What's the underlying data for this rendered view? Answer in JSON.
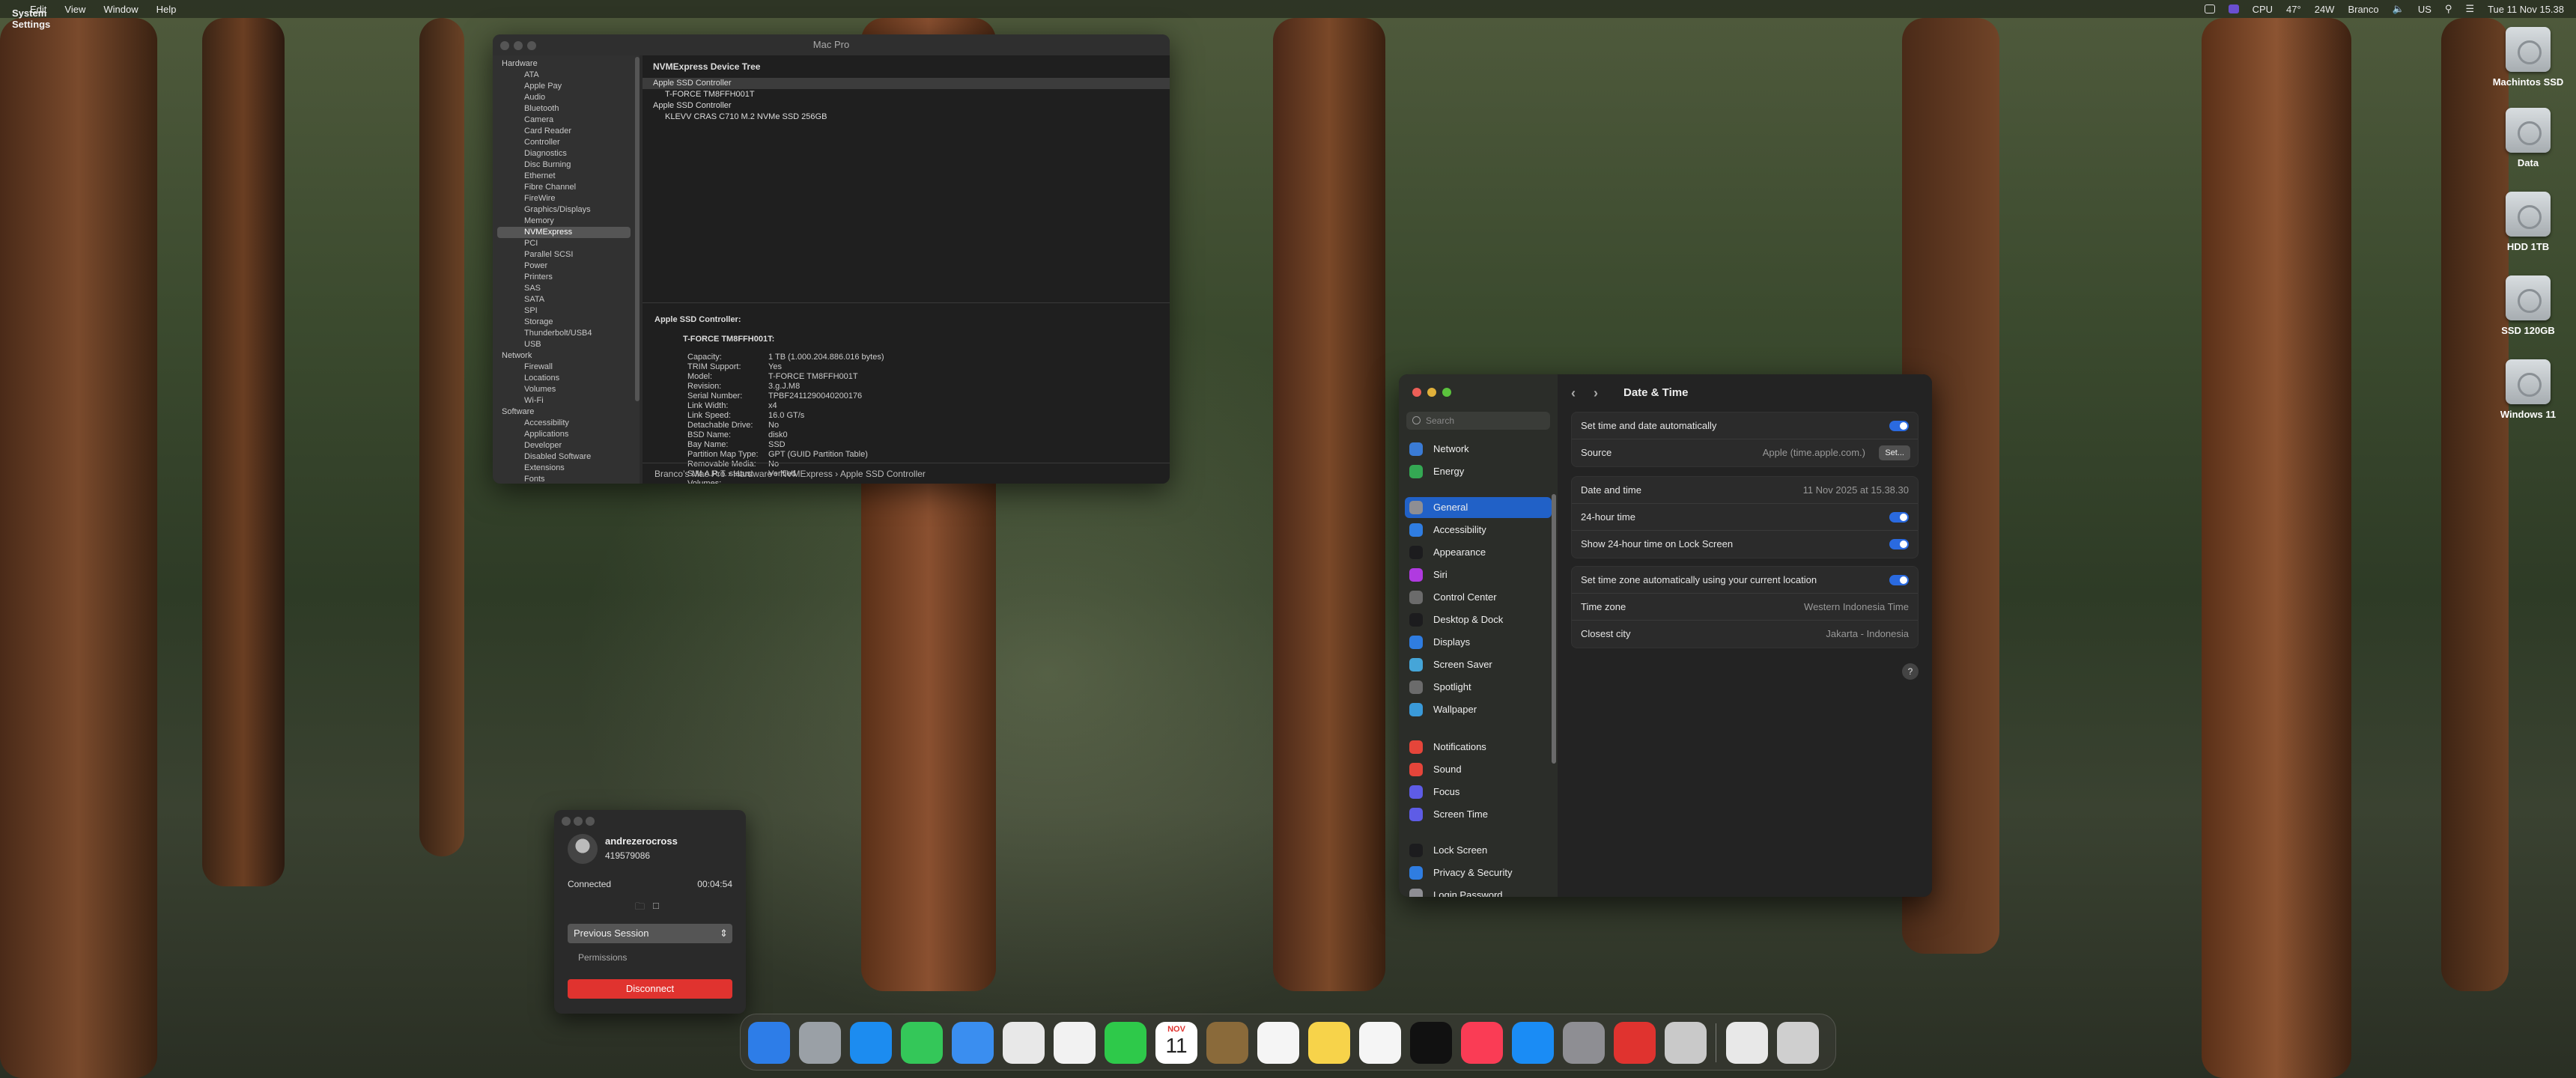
{
  "menubar": {
    "apple": "",
    "app": "System Settings",
    "items": [
      "Edit",
      "View",
      "Window",
      "Help"
    ],
    "cpu": "CPU",
    "temp": "47°",
    "power": "24W",
    "user": "Branco",
    "input": "US",
    "clock": "Tue 11 Nov 15.38"
  },
  "desktop": {
    "icons": [
      "Machintos SSD",
      "Data",
      "HDD 1TB",
      "SSD 120GB",
      "Windows 11"
    ]
  },
  "sysinfo": {
    "title": "Mac Pro",
    "sidebar": [
      {
        "t": "g",
        "label": "Hardware"
      },
      {
        "t": "i",
        "label": "ATA"
      },
      {
        "t": "i",
        "label": "Apple Pay"
      },
      {
        "t": "i",
        "label": "Audio"
      },
      {
        "t": "i",
        "label": "Bluetooth"
      },
      {
        "t": "i",
        "label": "Camera"
      },
      {
        "t": "i",
        "label": "Card Reader"
      },
      {
        "t": "i",
        "label": "Controller"
      },
      {
        "t": "i",
        "label": "Diagnostics"
      },
      {
        "t": "i",
        "label": "Disc Burning"
      },
      {
        "t": "i",
        "label": "Ethernet"
      },
      {
        "t": "i",
        "label": "Fibre Channel"
      },
      {
        "t": "i",
        "label": "FireWire"
      },
      {
        "t": "i",
        "label": "Graphics/Displays"
      },
      {
        "t": "i",
        "label": "Memory"
      },
      {
        "t": "s",
        "label": "NVMExpress"
      },
      {
        "t": "i",
        "label": "PCI"
      },
      {
        "t": "i",
        "label": "Parallel SCSI"
      },
      {
        "t": "i",
        "label": "Power"
      },
      {
        "t": "i",
        "label": "Printers"
      },
      {
        "t": "i",
        "label": "SAS"
      },
      {
        "t": "i",
        "label": "SATA"
      },
      {
        "t": "i",
        "label": "SPI"
      },
      {
        "t": "i",
        "label": "Storage"
      },
      {
        "t": "i",
        "label": "Thunderbolt/USB4"
      },
      {
        "t": "i",
        "label": "USB"
      },
      {
        "t": "g",
        "label": "Network"
      },
      {
        "t": "i",
        "label": "Firewall"
      },
      {
        "t": "i",
        "label": "Locations"
      },
      {
        "t": "i",
        "label": "Volumes"
      },
      {
        "t": "i",
        "label": "Wi-Fi"
      },
      {
        "t": "g",
        "label": "Software"
      },
      {
        "t": "i",
        "label": "Accessibility"
      },
      {
        "t": "i",
        "label": "Applications"
      },
      {
        "t": "i",
        "label": "Developer"
      },
      {
        "t": "i",
        "label": "Disabled Software"
      },
      {
        "t": "i",
        "label": "Extensions"
      },
      {
        "t": "i",
        "label": "Fonts"
      }
    ],
    "tree_header": "NVMExpress Device Tree",
    "tree": [
      {
        "t": "r",
        "label": "Apple SSD Controller"
      },
      {
        "t": "c",
        "label": "T-FORCE TM8FFH001T"
      },
      {
        "t": "r",
        "label": "Apple SSD Controller"
      },
      {
        "t": "c",
        "label": "KLEVV CRAS C710 M.2 NVMe SSD 256GB"
      }
    ],
    "detail_title": "Apple SSD Controller:",
    "detail_sub": "T-FORCE TM8FFH001T:",
    "details": [
      {
        "k": "Capacity:",
        "v": "1 TB (1.000.204.886.016 bytes)"
      },
      {
        "k": "TRIM Support:",
        "v": "Yes"
      },
      {
        "k": "Model:",
        "v": "T-FORCE TM8FFH001T"
      },
      {
        "k": "Revision:",
        "v": "3.g.J.M8"
      },
      {
        "k": "Serial Number:",
        "v": "TPBF2411290040200176"
      },
      {
        "k": "Link Width:",
        "v": "x4"
      },
      {
        "k": "Link Speed:",
        "v": "16.0 GT/s"
      },
      {
        "k": "Detachable Drive:",
        "v": "No"
      },
      {
        "k": "BSD Name:",
        "v": "disk0"
      },
      {
        "k": "Bay Name:",
        "v": "SSD"
      },
      {
        "k": "Partition Map Type:",
        "v": "GPT (GUID Partition Table)"
      },
      {
        "k": "Removable Media:",
        "v": "No"
      },
      {
        "k": "S.M.A.R.T. status:",
        "v": "Verified"
      },
      {
        "k": "Volumes:",
        "v": ""
      }
    ],
    "breadcrumb": "Branco’s Mac Pro › Hardware › NVMExpress › Apple SSD Controller"
  },
  "settings": {
    "search_placeholder": "Search",
    "nav": [
      {
        "label": "Network",
        "color": "#3a7bd5"
      },
      {
        "label": "Energy",
        "color": "#34a853"
      },
      {
        "label": "General",
        "color": "#8e8e93",
        "active": true
      },
      {
        "label": "Accessibility",
        "color": "#2f7de1"
      },
      {
        "label": "Appearance",
        "color": "#1c1c1e"
      },
      {
        "label": "Siri",
        "color": "#b03ae0"
      },
      {
        "label": "Control Center",
        "color": "#6b6b6b"
      },
      {
        "label": "Desktop & Dock",
        "color": "#1c1c1e"
      },
      {
        "label": "Displays",
        "color": "#2f7de1"
      },
      {
        "label": "Screen Saver",
        "color": "#45a5d8"
      },
      {
        "label": "Spotlight",
        "color": "#6b6b6b"
      },
      {
        "label": "Wallpaper",
        "color": "#3a9ad9"
      },
      {
        "label": "Notifications",
        "color": "#e5453a"
      },
      {
        "label": "Sound",
        "color": "#e5453a"
      },
      {
        "label": "Focus",
        "color": "#5e5ce6"
      },
      {
        "label": "Screen Time",
        "color": "#5e5ce6"
      },
      {
        "label": "Lock Screen",
        "color": "#1c1c1e"
      },
      {
        "label": "Privacy & Security",
        "color": "#2f7de1"
      },
      {
        "label": "Login Password",
        "color": "#8e8e93"
      }
    ],
    "page_title": "Date & Time",
    "rows": {
      "auto_time": "Set time and date automatically",
      "source_label": "Source",
      "source_value": "Apple (time.apple.com.)",
      "set_button": "Set...",
      "date_label": "Date and time",
      "date_value": "11 Nov 2025 at 15.38.30",
      "h24": "24-hour time",
      "h24_lock": "Show 24-hour time on Lock Screen",
      "tz_auto": "Set time zone automatically using your current location",
      "tz_label": "Time zone",
      "tz_value": "Western Indonesia Time",
      "city_label": "Closest city",
      "city_value": "Jakarta - Indonesia"
    },
    "help": "?"
  },
  "teamviewer": {
    "name": "andrezerocross",
    "id": "419579086",
    "status": "Connected",
    "timer": "00:04:54",
    "session": "Previous Session",
    "permissions": "Permissions",
    "disconnect": "Disconnect"
  },
  "dock": {
    "calendar_month": "NOV",
    "calendar_day": "11",
    "apps": [
      "finder-icon",
      "launchpad-icon",
      "safari-icon",
      "messages-icon",
      "mail-icon",
      "maps-icon",
      "photos-icon",
      "facetime-icon",
      "calendar-icon",
      "notes-brown-icon",
      "reminders-icon",
      "notes-icon",
      "freeform-icon",
      "tv-icon",
      "music-icon",
      "appstore-icon",
      "settings-icon",
      "anydesk-icon",
      "automator-icon",
      "preview-icon",
      "trash-icon"
    ]
  }
}
